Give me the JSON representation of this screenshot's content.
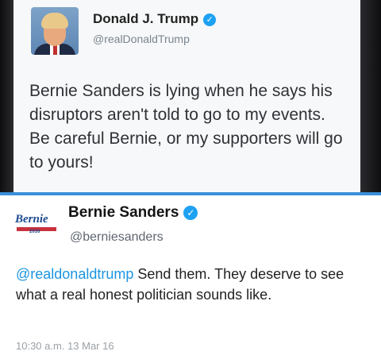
{
  "trump_tweet": {
    "name": "Donald J. Trump",
    "handle": "@realDonaldTrump",
    "text": "Bernie Sanders is lying when he says his disruptors aren't told to go to my events. Be careful Bernie, or my supporters will go to yours!",
    "verified_icon": "verified-badge-icon"
  },
  "bernie_tweet": {
    "name": "Bernie Sanders",
    "handle": "@berniesanders",
    "mention": "@realdonaldtrump",
    "text": " Send them. They deserve to see what a real honest politician sounds like.",
    "timestamp": "10:30 a.m.  13 Mar 16",
    "verified_icon": "verified-badge-icon",
    "logo_text": "Bernie",
    "logo_year": "2016"
  },
  "colors": {
    "verified": "#1da1f2",
    "separator": "#3a8fd9",
    "mention": "#1b95e0"
  }
}
